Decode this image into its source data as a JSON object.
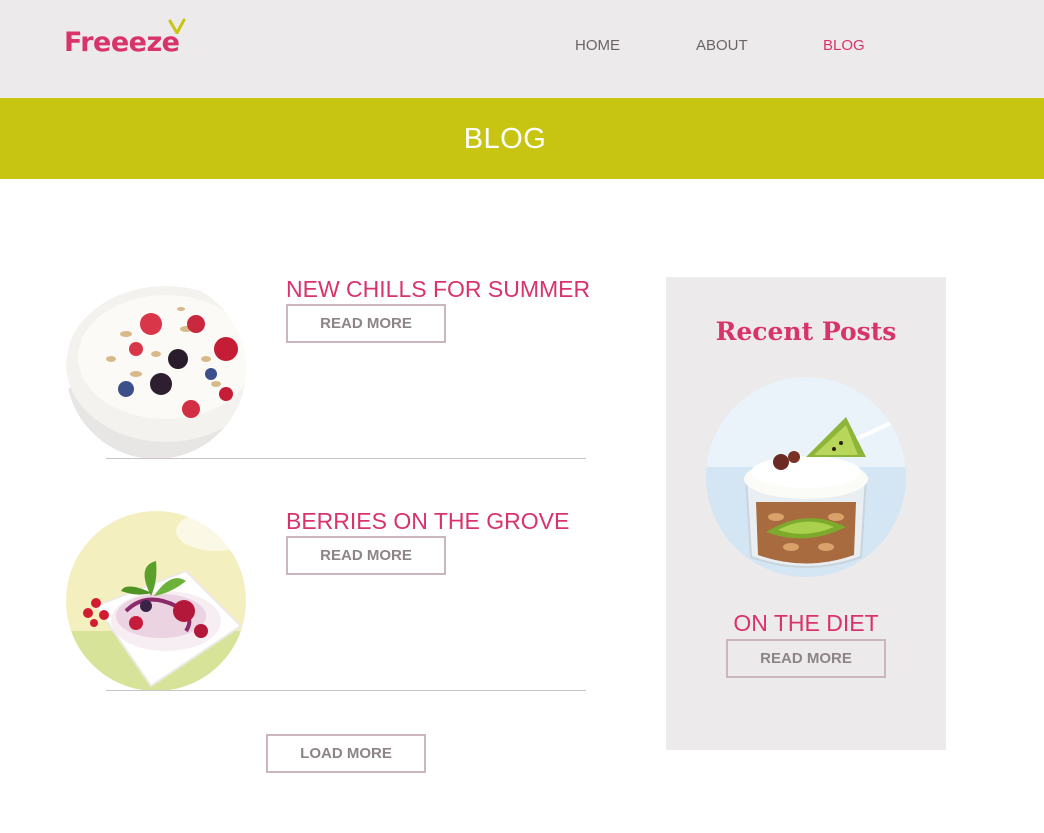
{
  "header": {
    "logo_text": "Freeeze",
    "nav": [
      {
        "label": "HOME"
      },
      {
        "label": "ABOUT"
      },
      {
        "label": "BLOG"
      }
    ],
    "active_nav": "BLOG"
  },
  "banner": {
    "title": "BLOG"
  },
  "posts": [
    {
      "title": "NEW CHILLS FOR SUMMER",
      "button": "READ MORE",
      "image": "yogurt-berries-granola-bowl"
    },
    {
      "title": "BERRIES ON THE GROVE",
      "button": "READ MORE",
      "image": "berry-cream-dessert-square-bowl"
    }
  ],
  "load_more": "LOAD MORE",
  "sidebar": {
    "title": "Recent Posts",
    "post": {
      "title": "ON THE DIET",
      "button": "READ MORE",
      "image": "kiwi-granola-yogurt-jar"
    }
  },
  "colors": {
    "accent": "#d8336b",
    "banner": "#c8c512",
    "header_bg": "#edeaeb",
    "nav_text": "#6b6467"
  }
}
